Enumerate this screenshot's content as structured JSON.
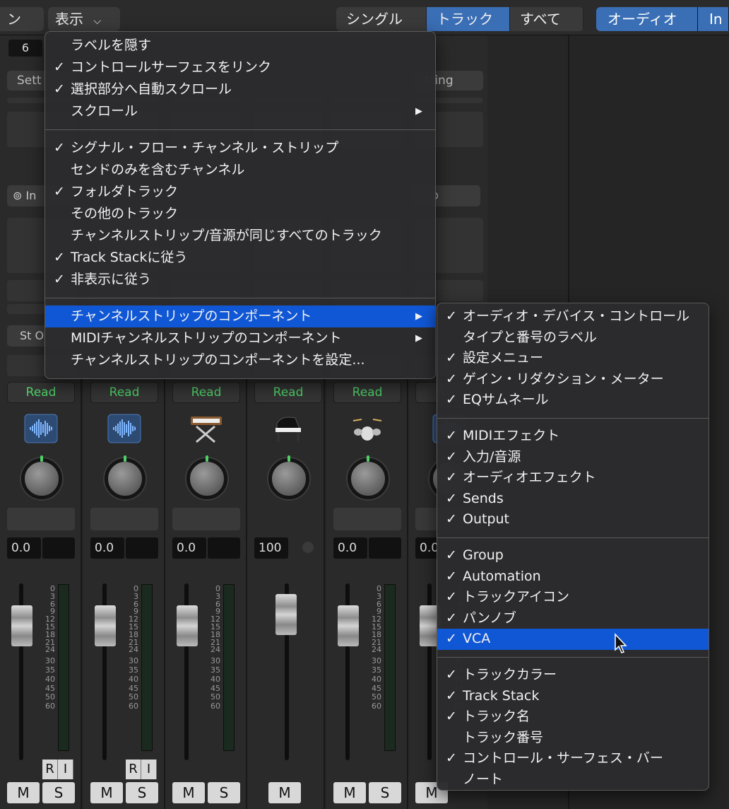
{
  "topbar": {
    "left_dd": "ン",
    "view_menu": "表示",
    "scope": [
      "シングル",
      "トラック",
      "すべて"
    ],
    "scope_selected": "トラック",
    "filters": [
      "オーディオ",
      "In"
    ]
  },
  "strips": [
    {
      "num": "6",
      "setting": "Sett",
      "read": "Read",
      "value": "0.0",
      "icon": "waveform-icon"
    },
    {
      "num": "",
      "setting": "",
      "read": "Read",
      "value": "0.0",
      "icon": "waveform-icon"
    },
    {
      "num": "",
      "setting": "",
      "read": "Read",
      "value": "0.0",
      "icon": "synth-icon"
    },
    {
      "num": "",
      "setting": "",
      "read": "Read",
      "value": "100",
      "icon": "piano-icon"
    },
    {
      "num": "",
      "setting": "",
      "read": "Read",
      "value": "0.0",
      "icon": "drums-icon"
    },
    {
      "num": "",
      "setting": "tting",
      "read": "R",
      "value": "0.0",
      "icon": "waveform-icon"
    }
  ],
  "strip_labels": {
    "link_in": "In",
    "st_out": "St O",
    "r": "R",
    "i": "I",
    "m": "M",
    "s": "S",
    "d": "D"
  },
  "scale": [
    "0",
    "3",
    "6",
    "9",
    "12",
    "15",
    "18",
    "21",
    "24",
    "30",
    "35",
    "40",
    "45",
    "50",
    "60"
  ],
  "view_menu": {
    "group1": [
      {
        "label": "ラベルを隠す",
        "checked": false
      },
      {
        "label": "コントロールサーフェスをリンク",
        "checked": true
      },
      {
        "label": "選択部分へ自動スクロール",
        "checked": true
      },
      {
        "label": "スクロール",
        "checked": false,
        "submenu": true
      }
    ],
    "group2": [
      {
        "label": "シグナル・フロー・チャンネル・ストリップ",
        "checked": true
      },
      {
        "label": "センドのみを含むチャンネル",
        "checked": false
      },
      {
        "label": "フォルダトラック",
        "checked": true
      },
      {
        "label": "その他のトラック",
        "checked": false
      },
      {
        "label": "チャンネルストリップ/音源が同じすべてのトラック",
        "checked": false
      },
      {
        "label": "Track Stackに従う",
        "checked": true
      },
      {
        "label": "非表示に従う",
        "checked": true
      }
    ],
    "group3": [
      {
        "label": "チャンネルストリップのコンポーネント",
        "checked": false,
        "submenu": true,
        "highlighted": true
      },
      {
        "label": "MIDIチャンネルストリップのコンポーネント",
        "checked": false,
        "submenu": true
      },
      {
        "label": "チャンネルストリップのコンポーネントを設定...",
        "checked": false
      }
    ]
  },
  "components_menu": {
    "group1": [
      "オーディオ・デバイス・コントロール",
      "タイプと番号のラベル",
      "設定メニュー",
      "ゲイン・リダクション・メーター",
      "EQサムネール"
    ],
    "group1_checked": [
      true,
      false,
      true,
      true,
      true
    ],
    "group2": [
      "MIDIエフェクト",
      "入力/音源",
      "オーディオエフェクト",
      "Sends",
      "Output"
    ],
    "group3": [
      "Group",
      "Automation",
      "トラックアイコン",
      "パンノブ",
      "VCA"
    ],
    "group4": [
      "トラックカラー",
      "Track Stack",
      "トラック名",
      "トラック番号",
      "コントロール・サーフェス・バー",
      "ノート"
    ],
    "group4_checked": [
      true,
      true,
      true,
      false,
      true,
      false
    ],
    "highlighted": "VCA"
  },
  "check_mark": "✓",
  "arrow": "▶",
  "colors": {
    "accent": "#1057d6",
    "segment": "#3a6eb5",
    "read_green": "#4fd168"
  }
}
